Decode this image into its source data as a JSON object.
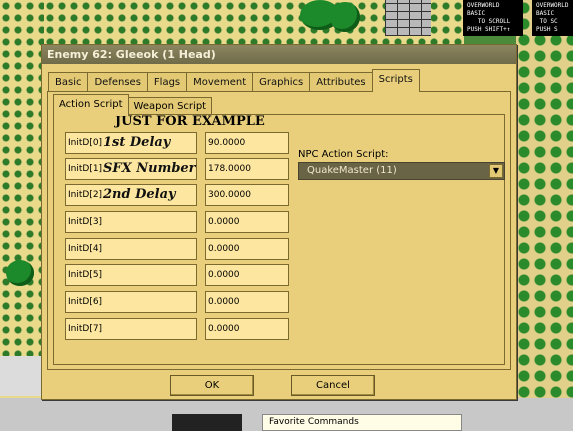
{
  "background": {
    "hud_left_text": "OVERWORLD\nBASIC\n   TO SCROLL\nPUSH SHIFT+↑",
    "hud_right_text": "OVERWORLD\nBASIC\n TO SC\nPUSH S",
    "favorite_commands_label": "Favorite Commands"
  },
  "dialog": {
    "title": "Enemy 62: Gleeok (1 Head)",
    "tabs": [
      "Basic",
      "Defenses",
      "Flags",
      "Movement",
      "Graphics",
      "Attributes",
      "Scripts"
    ],
    "active_tab": "Scripts",
    "subtabs": [
      "Action Script",
      "Weapon Script"
    ],
    "active_subtab": "Action Script",
    "overlay_heading": "JUST FOR EXAMPLE",
    "init_rows": [
      {
        "label": "InitD[0]",
        "value": "90.0000",
        "note": "1st Delay"
      },
      {
        "label": "InitD[1]",
        "value": "178.0000",
        "note": "SFX Number"
      },
      {
        "label": "InitD[2]",
        "value": "300.0000",
        "note": "2nd Delay"
      },
      {
        "label": "InitD[3]",
        "value": "0.0000",
        "note": ""
      },
      {
        "label": "InitD[4]",
        "value": "0.0000",
        "note": ""
      },
      {
        "label": "InitD[5]",
        "value": "0.0000",
        "note": ""
      },
      {
        "label": "InitD[6]",
        "value": "0.0000",
        "note": ""
      },
      {
        "label": "InitD[7]",
        "value": "0.0000",
        "note": ""
      }
    ],
    "npc_script_label": "NPC Action Script:",
    "npc_script_value": "QuakeMaster (11)",
    "ok_label": "OK",
    "cancel_label": "Cancel"
  }
}
